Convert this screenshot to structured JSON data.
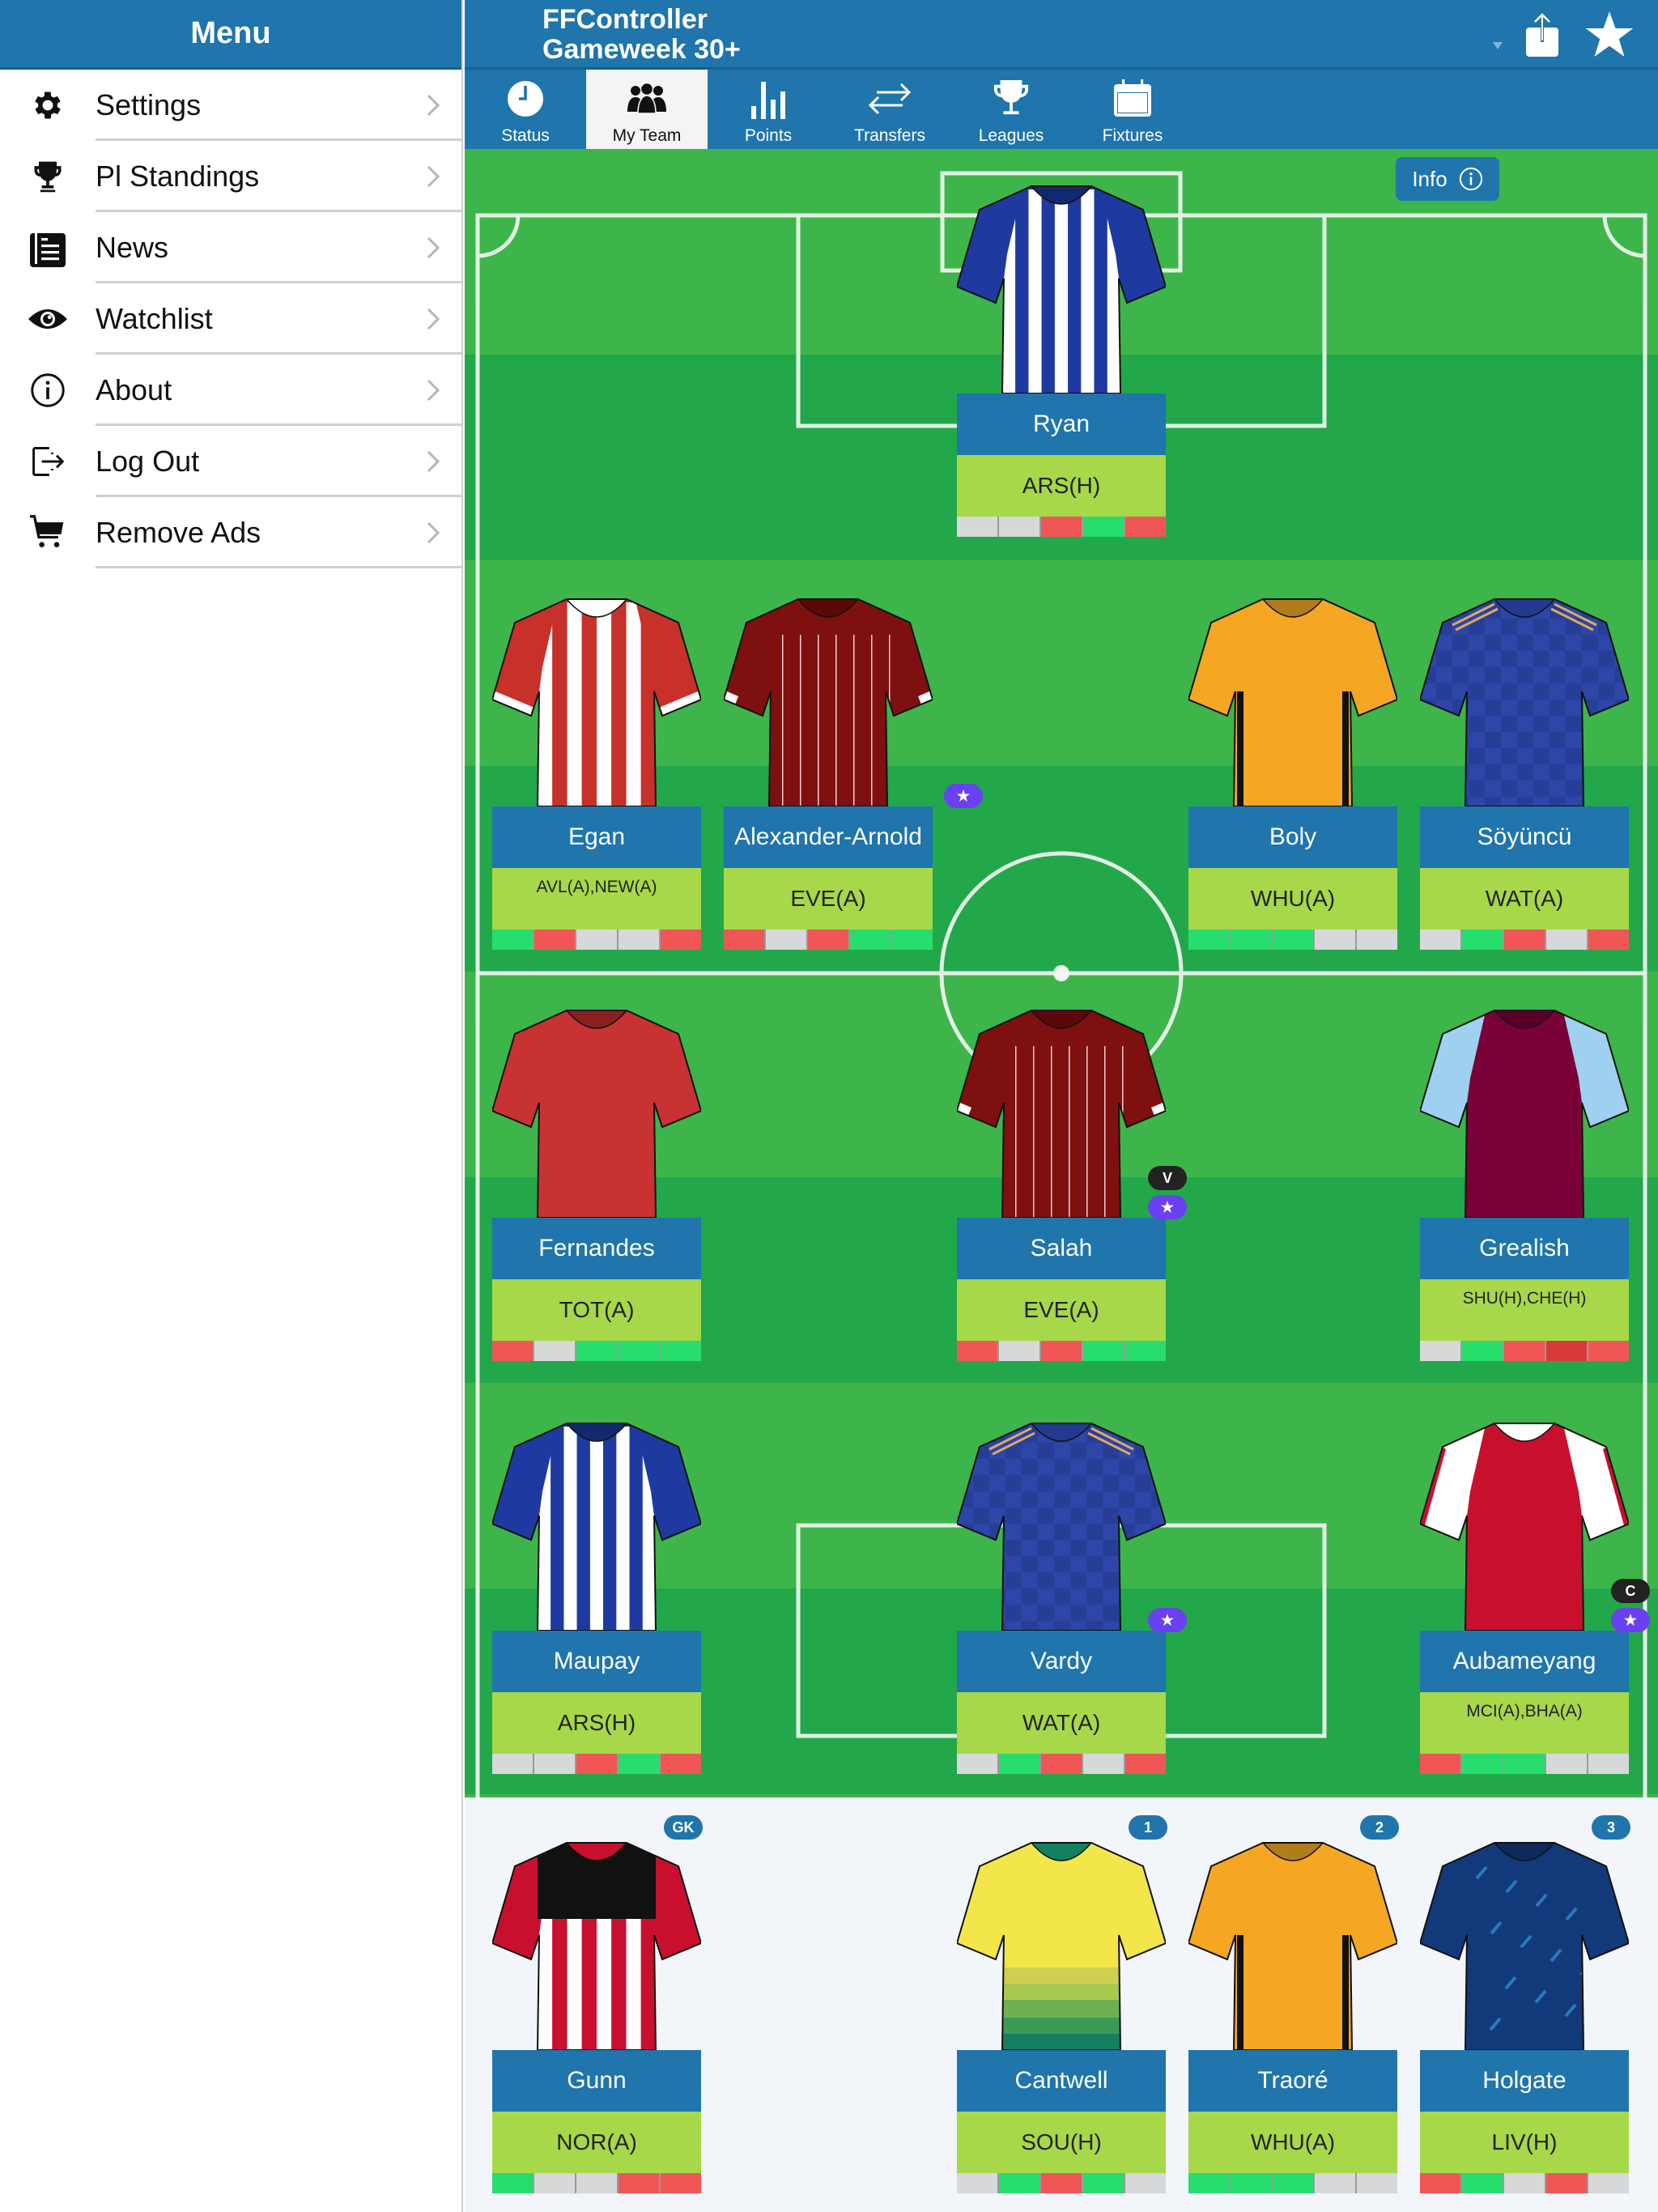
{
  "sidebar": {
    "title": "Menu",
    "items": [
      {
        "label": "Settings",
        "icon": "gear-icon"
      },
      {
        "label": "Pl Standings",
        "icon": "trophy-icon"
      },
      {
        "label": "News",
        "icon": "newspaper-icon"
      },
      {
        "label": "Watchlist",
        "icon": "eye-icon"
      },
      {
        "label": "About",
        "icon": "info-icon"
      },
      {
        "label": "Log Out",
        "icon": "logout-icon"
      },
      {
        "label": "Remove Ads",
        "icon": "cart-icon"
      }
    ]
  },
  "header": {
    "title_line1": "FFController",
    "title_line2": "Gameweek 30+",
    "share_icon": "share-icon",
    "favorite_icon": "star-icon"
  },
  "tabs": [
    {
      "label": "Status",
      "icon": "clock-icon",
      "active": false
    },
    {
      "label": "My Team",
      "icon": "team-icon",
      "active": true
    },
    {
      "label": "Points",
      "icon": "bar-chart-icon",
      "active": false
    },
    {
      "label": "Transfers",
      "icon": "transfer-arrows-icon",
      "active": false
    },
    {
      "label": "Leagues",
      "icon": "trophy-icon",
      "active": false
    },
    {
      "label": "Fixtures",
      "icon": "calendar-icon",
      "active": false
    }
  ],
  "info_button": {
    "label": "Info"
  },
  "colors": {
    "brand_blue": "#1f75ac",
    "fixture_green": "#a6d84a",
    "form_win": "#26dd6e",
    "form_loss": "#f05656",
    "form_loss_dark": "#d83a3a",
    "form_none": "#d7d8da",
    "star_badge": "#6b3ff2"
  },
  "starting_xi": [
    {
      "name": "Ryan",
      "fixture": "ARS(H)",
      "kit": "stripes-blue",
      "form": [
        "none",
        "none",
        "loss",
        "win",
        "loss"
      ],
      "badges": []
    },
    {
      "name": "Egan",
      "fixture": "AVL(A),NEW(A)",
      "kit": "stripes-red",
      "form": [
        "win",
        "loss",
        "none",
        "none",
        "loss"
      ],
      "badges": []
    },
    {
      "name": "Alexander-Arnold",
      "fixture": "EVE(A)",
      "kit": "pinstripe-maroon",
      "form": [
        "loss",
        "none",
        "loss",
        "win",
        "win"
      ],
      "badges": [
        "star"
      ]
    },
    {
      "name": "Boly",
      "fixture": "WHU(A)",
      "kit": "plain-orange",
      "form": [
        "win",
        "win",
        "win",
        "none",
        "none"
      ],
      "badges": []
    },
    {
      "name": "Söyüncü",
      "fixture": "WAT(A)",
      "kit": "check-blue",
      "form": [
        "none",
        "win",
        "loss",
        "none",
        "loss"
      ],
      "badges": []
    },
    {
      "name": "Fernandes",
      "fixture": "TOT(A)",
      "kit": "plain-red",
      "form": [
        "loss",
        "none",
        "win",
        "win",
        "win"
      ],
      "badges": []
    },
    {
      "name": "Salah",
      "fixture": "EVE(A)",
      "kit": "pinstripe-maroon",
      "form": [
        "loss",
        "none",
        "loss",
        "win",
        "win"
      ],
      "badges": [
        "V",
        "star"
      ]
    },
    {
      "name": "Grealish",
      "fixture": "SHU(H),CHE(H)",
      "kit": "claret-skyblue",
      "form": [
        "none",
        "win",
        "loss",
        "loss_dark",
        "loss"
      ],
      "badges": []
    },
    {
      "name": "Maupay",
      "fixture": "ARS(H)",
      "kit": "stripes-blue",
      "form": [
        "none",
        "none",
        "loss",
        "win",
        "loss"
      ],
      "badges": []
    },
    {
      "name": "Vardy",
      "fixture": "WAT(A)",
      "kit": "check-blue",
      "form": [
        "none",
        "win",
        "loss",
        "none",
        "loss"
      ],
      "badges": [
        "star"
      ]
    },
    {
      "name": "Aubameyang",
      "fixture": "MCI(A),BHA(A)",
      "kit": "red-white-sleeves",
      "form": [
        "loss",
        "win",
        "win",
        "none",
        "none"
      ],
      "badges": [
        "C",
        "star"
      ]
    }
  ],
  "bench": [
    {
      "name": "Gunn",
      "fixture": "NOR(A)",
      "kit": "stripes-red-black",
      "form": [
        "win",
        "none",
        "none",
        "loss",
        "loss"
      ],
      "badge": "GK"
    },
    {
      "name": "Cantwell",
      "fixture": "SOU(H)",
      "kit": "yellow-green",
      "form": [
        "none",
        "win",
        "loss",
        "win",
        "none"
      ],
      "badge": "1"
    },
    {
      "name": "Traoré",
      "fixture": "WHU(A)",
      "kit": "plain-orange",
      "form": [
        "win",
        "win",
        "win",
        "none",
        "none"
      ],
      "badge": "2"
    },
    {
      "name": "Holgate",
      "fixture": "LIV(H)",
      "kit": "navy-pattern",
      "form": [
        "loss",
        "win",
        "none",
        "loss",
        "none"
      ],
      "badge": "3"
    }
  ]
}
